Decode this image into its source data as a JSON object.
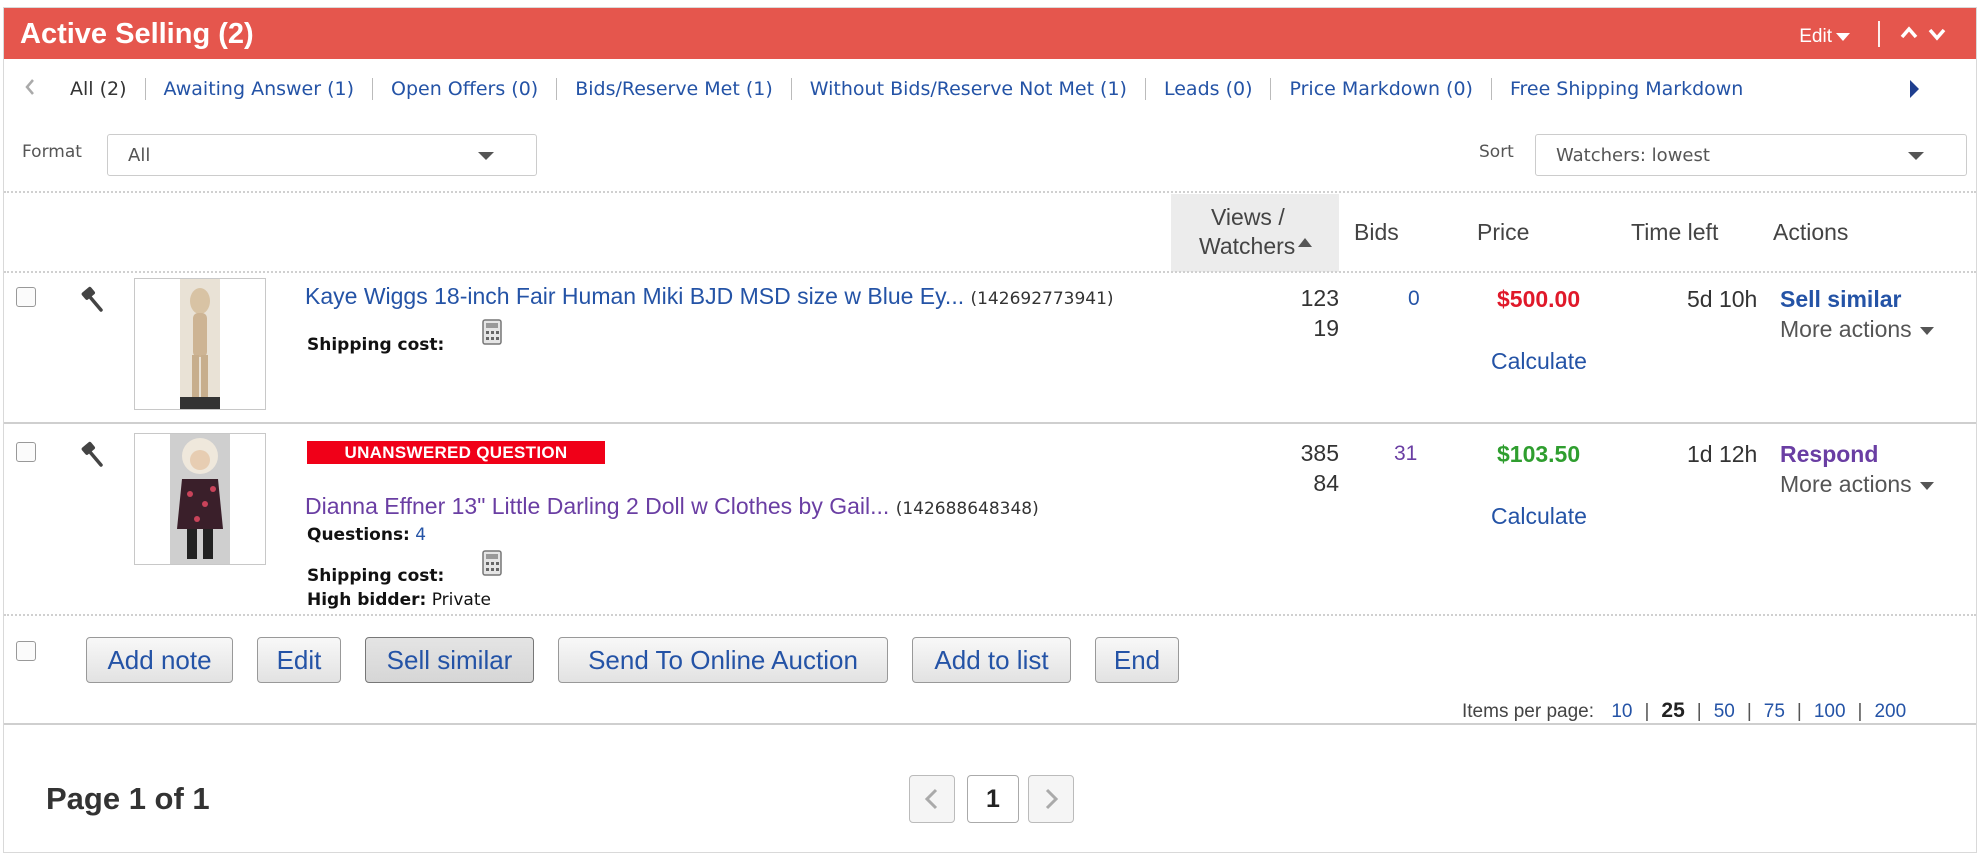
{
  "header": {
    "title": "Active Selling (2)",
    "edit_label": "Edit"
  },
  "filters": {
    "tabs": [
      "All (2)",
      "Awaiting Answer (1)",
      "Open Offers (0)",
      "Bids/Reserve Met (1)",
      "Without Bids/Reserve Not Met (1)",
      "Leads (0)",
      "Price Markdown (0)",
      "Free Shipping Markdown"
    ]
  },
  "format": {
    "label": "Format",
    "value": "All"
  },
  "sort": {
    "label": "Sort",
    "value": "Watchers: lowest"
  },
  "columns": {
    "views_line1": "Views /",
    "views_line2": "Watchers",
    "bids": "Bids",
    "price": "Price",
    "time_left": "Time left",
    "actions": "Actions"
  },
  "rows": [
    {
      "title": "Kaye Wiggs 18-inch Fair Human Miki BJD MSD size w Blue Ey...",
      "item_id": "(142692773941)",
      "shipping_label": "Shipping cost:",
      "views": "123",
      "watchers": "19",
      "bids": "0",
      "price": "$500.00",
      "price_color": "#e0192a",
      "calculate": "Calculate",
      "time_left": "5d 10h",
      "primary_action": "Sell similar",
      "more_actions": "More actions"
    },
    {
      "badge": "UNANSWERED QUESTION",
      "title": "Dianna Effner 13\" Little Darling 2 Doll w Clothes by Gail...",
      "item_id": "(142688648348)",
      "questions_label": "Questions:",
      "questions_count": "4",
      "shipping_label": "Shipping cost:",
      "high_bidder_label": "High bidder:",
      "high_bidder_value": "Private",
      "views": "385",
      "watchers": "84",
      "bids": "31",
      "price": "$103.50",
      "price_color": "#2f9e2f",
      "calculate": "Calculate",
      "time_left": "1d 12h",
      "primary_action": "Respond",
      "more_actions": "More actions"
    }
  ],
  "bulk_buttons": [
    "Add note",
    "Edit",
    "Sell similar",
    "Send To Online Auction",
    "Add to list",
    "End"
  ],
  "items_per_page": {
    "label": "Items per page:",
    "options": [
      "10",
      "25",
      "50",
      "75",
      "100",
      "200"
    ],
    "selected": "25"
  },
  "pagination": {
    "summary": "Page 1 of 1",
    "current": "1"
  },
  "colors": {
    "header_bg": "#e5564d",
    "link": "#2453a6",
    "visited_link": "#6a3ea3"
  }
}
